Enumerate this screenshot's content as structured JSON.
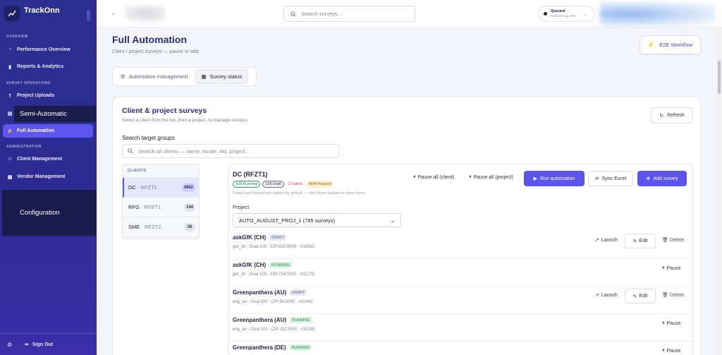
{
  "app": {
    "name": "TrackOnn"
  },
  "sidebar": {
    "sections": {
      "overview": "OVERVIEW",
      "survey_ops": "SURVEY OPERATIONS",
      "admin": "ADMINISTRATION"
    },
    "items": [
      {
        "label": "Performance Overview"
      },
      {
        "label": "Reports & Analytics"
      },
      {
        "label": "Project Uploads"
      },
      {
        "label": "Full Automation"
      },
      {
        "label": "Client Management"
      },
      {
        "label": "Vendor Management"
      }
    ],
    "semi_auto_label": "Semi-Automatic",
    "config_label": "Configuration",
    "sign_out": "Sign Out"
  },
  "header": {
    "search_placeholder": "Search surveys...",
    "queue": {
      "title": "Queued",
      "sub": "Next 11 Aug, 0:00"
    }
  },
  "page": {
    "title": "Full Automation",
    "subtitle": "Client / project surveys — pause or add",
    "e2e_label": "E2E Workflow",
    "tabs": [
      {
        "label": "Automation management"
      },
      {
        "label": "Survey status"
      }
    ]
  },
  "card": {
    "title": "Client & project surveys",
    "subtitle": "Select a client from the list, then a project, to manage surveys.",
    "refresh_label": "Refresh",
    "search_label": "Search target groups",
    "search_placeholder": "Search all clients — name, locale, #id, project..."
  },
  "clients": {
    "header": "CLIENTS",
    "rows": [
      {
        "name": "DC",
        "code": "RFZT1",
        "count": "4862"
      },
      {
        "name": "RFG",
        "code": "RFET1",
        "count": "144"
      },
      {
        "name": "SME",
        "code": "RFZT2",
        "count": "26"
      }
    ]
  },
  "detail": {
    "title": "DC (RFZT1)",
    "chips": {
      "running": "108 Running",
      "draft": "108 Draft",
      "failed": "2 Failed",
      "paused": "4644 Paused"
    },
    "hidden_note": "Failed and Paused are hidden by default — click those badges to show them.",
    "pause_client": "Pause all (client)",
    "pause_project": "Pause all (project)",
    "run_label": "Run automation",
    "sync_label": "Sync Excel",
    "add_label": "Add survey",
    "project_label": "Project",
    "project_value": "AUTO_AUGUST_PROJ_1 (785 surveys)"
  },
  "surveys": [
    {
      "name": "askGfK (CH)",
      "status": "DRAFT",
      "meta": "ger_ch · Goal 100 · CPI 630.0000 · #32452",
      "launch": "Launch",
      "edit": "Edit",
      "delete": "Delete"
    },
    {
      "name": "askGfK (CH)",
      "status": "RUNNING",
      "meta": "ger_ch · Goal 100 · CPI 724.5000 · #32175",
      "pause": "Pause"
    },
    {
      "name": "Greenpanthera (AU)",
      "status": "DRAFT",
      "meta": "eng_au · Goal 100 · CPI 94.5000 · #32442",
      "launch": "Launch",
      "edit": "Edit",
      "delete": "Delete"
    },
    {
      "name": "Greenpanthera (AU)",
      "status": "RUNNING",
      "meta": "eng_au · Goal 100 · CPI 112.5000 · #32165",
      "pause": "Pause"
    },
    {
      "name": "Greenpanthera (DE)",
      "status": "RUNNING",
      "meta": "",
      "pause": "Pause"
    }
  ]
}
